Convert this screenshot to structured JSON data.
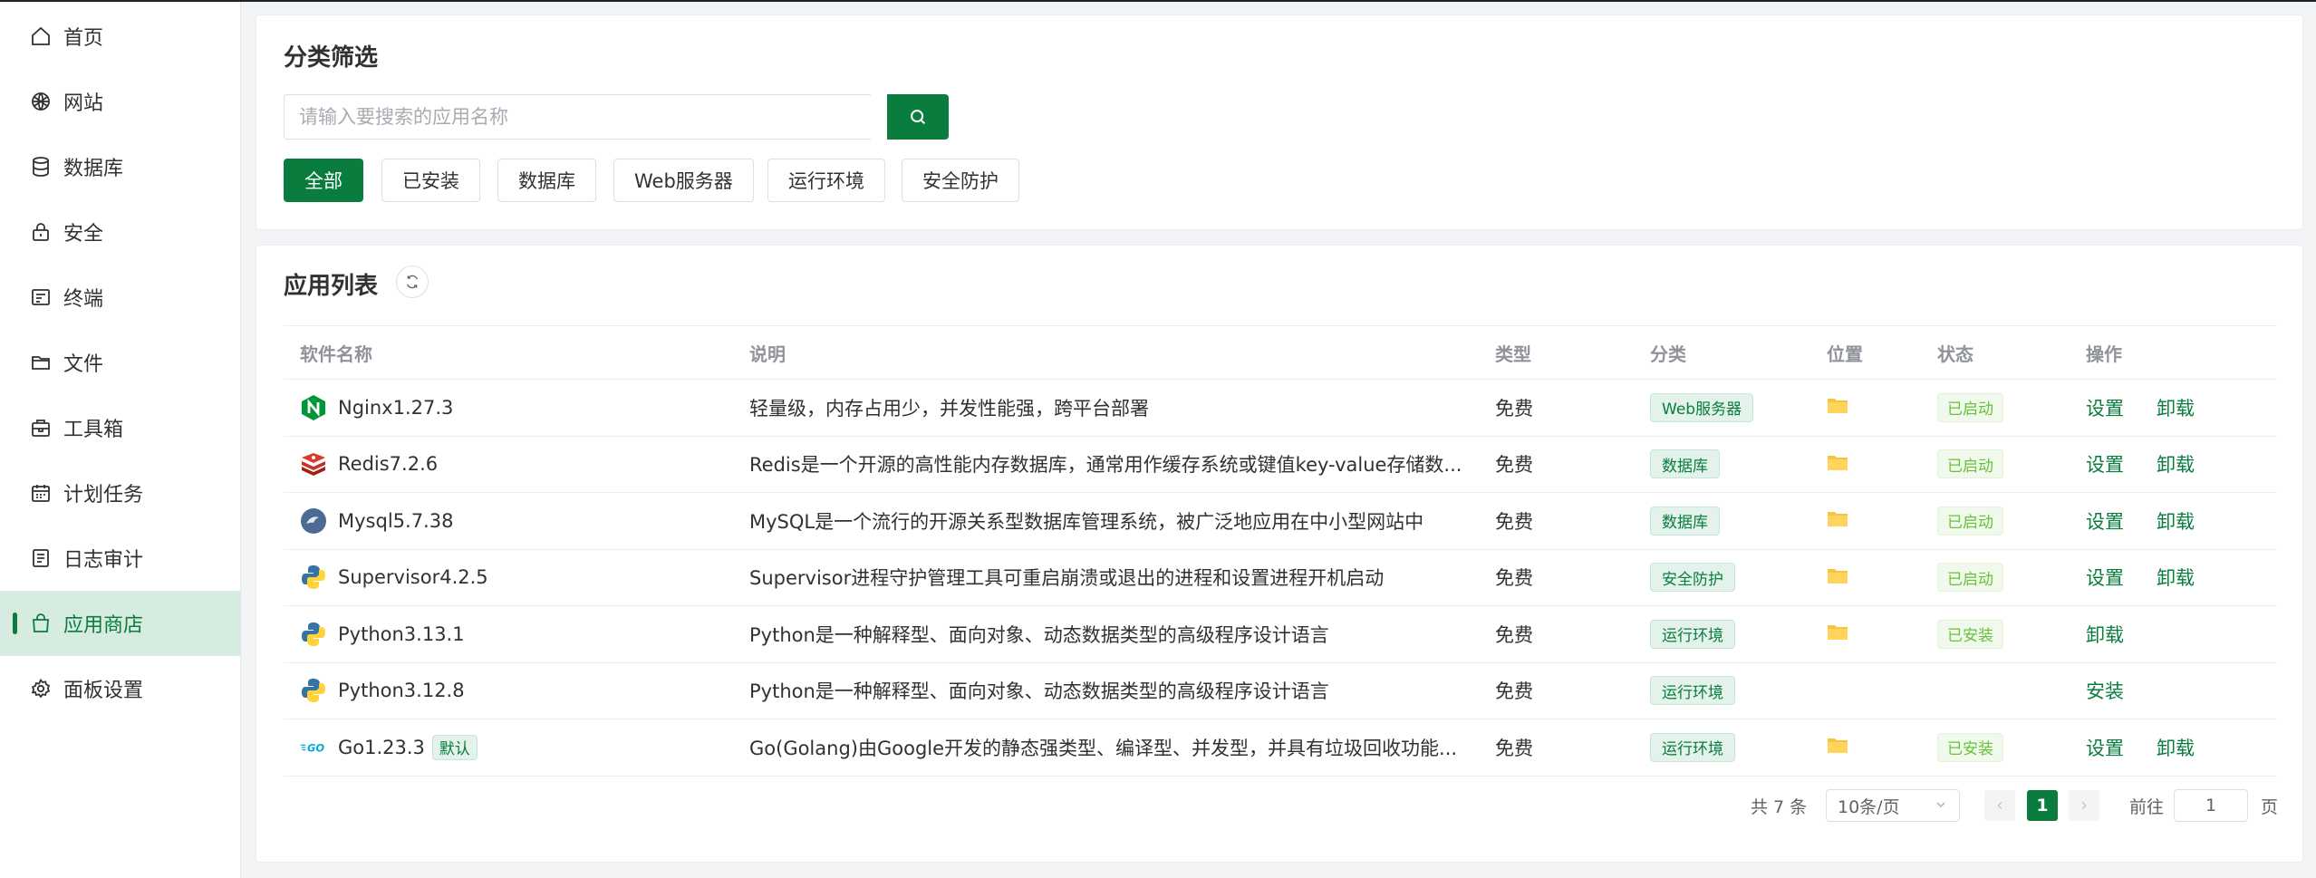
{
  "sidebar": {
    "items": [
      {
        "label": "首页",
        "icon": "home-icon"
      },
      {
        "label": "网站",
        "icon": "globe-icon"
      },
      {
        "label": "数据库",
        "icon": "database-icon"
      },
      {
        "label": "安全",
        "icon": "lock-icon"
      },
      {
        "label": "终端",
        "icon": "terminal-icon"
      },
      {
        "label": "文件",
        "icon": "folder-icon"
      },
      {
        "label": "工具箱",
        "icon": "toolbox-icon"
      },
      {
        "label": "计划任务",
        "icon": "calendar-icon"
      },
      {
        "label": "日志审计",
        "icon": "log-icon"
      },
      {
        "label": "应用商店",
        "icon": "store-icon",
        "active": true
      },
      {
        "label": "面板设置",
        "icon": "gear-icon"
      }
    ]
  },
  "filter": {
    "title": "分类筛选",
    "search_placeholder": "请输入要搜索的应用名称",
    "categories": [
      "全部",
      "已安装",
      "数据库",
      "Web服务器",
      "运行环境",
      "安全防护"
    ],
    "active_category": "全部"
  },
  "app_list": {
    "title": "应用列表",
    "columns": [
      "软件名称",
      "说明",
      "类型",
      "分类",
      "位置",
      "状态",
      "操作"
    ],
    "rows": [
      {
        "name": "Nginx1.27.3",
        "icon": "nginx-icon",
        "desc": "轻量级，内存占用少，并发性能强，跨平台部署",
        "type": "免费",
        "category": "Web服务器",
        "has_location": true,
        "status": "已启动",
        "ops": [
          "设置",
          "卸载"
        ]
      },
      {
        "name": "Redis7.2.6",
        "icon": "redis-icon",
        "desc": "Redis是一个开源的高性能内存数据库，通常用作缓存系统或键值key-value存储数...",
        "type": "免费",
        "category": "数据库",
        "has_location": true,
        "status": "已启动",
        "ops": [
          "设置",
          "卸载"
        ]
      },
      {
        "name": "Mysql5.7.38",
        "icon": "mysql-icon",
        "desc": "MySQL是一个流行的开源关系型数据库管理系统，被广泛地应用在中小型网站中",
        "type": "免费",
        "category": "数据库",
        "has_location": true,
        "status": "已启动",
        "ops": [
          "设置",
          "卸载"
        ]
      },
      {
        "name": "Supervisor4.2.5",
        "icon": "supervisor-icon",
        "desc": "Supervisor进程守护管理工具可重启崩溃或退出的进程和设置进程开机启动",
        "type": "免费",
        "category": "安全防护",
        "has_location": true,
        "status": "已启动",
        "ops": [
          "设置",
          "卸载"
        ]
      },
      {
        "name": "Python3.13.1",
        "icon": "python-icon",
        "desc": "Python是一种解释型、面向对象、动态数据类型的高级程序设计语言",
        "type": "免费",
        "category": "运行环境",
        "has_location": true,
        "status": "已安装",
        "ops": [
          "卸载"
        ]
      },
      {
        "name": "Python3.12.8",
        "icon": "python-icon",
        "desc": "Python是一种解释型、面向对象、动态数据类型的高级程序设计语言",
        "type": "免费",
        "category": "运行环境",
        "has_location": false,
        "status": "",
        "ops": [
          "安装"
        ]
      },
      {
        "name": "Go1.23.3",
        "icon": "go-icon",
        "tag": "默认",
        "desc": "Go(Golang)由Google开发的静态强类型、编译型、并发型，并具有垃圾回收功能...",
        "type": "免费",
        "category": "运行环境",
        "has_location": true,
        "status": "已安装",
        "ops": [
          "设置",
          "卸载"
        ]
      }
    ]
  },
  "pagination": {
    "total_text": "共 7 条",
    "page_size": "10条/页",
    "current_page": "1",
    "goto_label": "前往",
    "goto_value": "1",
    "page_suffix": "页"
  },
  "colors": {
    "accent": "#0a7c3e",
    "accent_light": "#d7ece1",
    "status_green": "#67c23a",
    "folder_yellow": "#f5c542"
  }
}
